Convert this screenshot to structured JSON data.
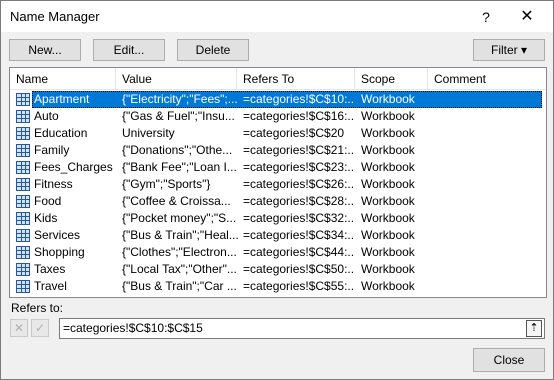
{
  "window": {
    "title": "Name Manager",
    "help_label": "?",
    "close_label": "✕"
  },
  "toolbar": {
    "new_label": "New...",
    "edit_label": "Edit...",
    "delete_label": "Delete",
    "filter_label": "Filter ▾"
  },
  "list": {
    "columns": [
      "Name",
      "Value",
      "Refers To",
      "Scope",
      "Comment"
    ],
    "rows": [
      {
        "name": "Apartment",
        "value": "{\"Electricity\";\"Fees\";...",
        "refers": "=categories!$C$10:...",
        "scope": "Workbook",
        "comment": "",
        "selected": true
      },
      {
        "name": "Auto",
        "value": "{\"Gas & Fuel\";\"Insu...",
        "refers": "=categories!$C$16:...",
        "scope": "Workbook",
        "comment": ""
      },
      {
        "name": "Education",
        "value": "University",
        "refers": "=categories!$C$20",
        "scope": "Workbook",
        "comment": ""
      },
      {
        "name": "Family",
        "value": "{\"Donations\";\"Othe...",
        "refers": "=categories!$C$21:...",
        "scope": "Workbook",
        "comment": ""
      },
      {
        "name": "Fees_Charges",
        "value": "{\"Bank Fee\";\"Loan I...",
        "refers": "=categories!$C$23:...",
        "scope": "Workbook",
        "comment": ""
      },
      {
        "name": "Fitness",
        "value": "{\"Gym\";\"Sports\"}",
        "refers": "=categories!$C$26:...",
        "scope": "Workbook",
        "comment": ""
      },
      {
        "name": "Food",
        "value": "{\"Coffee & Croissa...",
        "refers": "=categories!$C$28:...",
        "scope": "Workbook",
        "comment": ""
      },
      {
        "name": "Kids",
        "value": "{\"Pocket money\";\"S...",
        "refers": "=categories!$C$32:...",
        "scope": "Workbook",
        "comment": ""
      },
      {
        "name": "Services",
        "value": "{\"Bus & Train\";\"Heal...",
        "refers": "=categories!$C$34:...",
        "scope": "Workbook",
        "comment": ""
      },
      {
        "name": "Shopping",
        "value": "{\"Clothes\";\"Electron...",
        "refers": "=categories!$C$44:...",
        "scope": "Workbook",
        "comment": ""
      },
      {
        "name": "Taxes",
        "value": "{\"Local Tax\";\"Other\"...",
        "refers": "=categories!$C$50:...",
        "scope": "Workbook",
        "comment": ""
      },
      {
        "name": "Travel",
        "value": "{\"Bus & Train\";\"Car ...",
        "refers": "=categories!$C$55:...",
        "scope": "Workbook",
        "comment": ""
      }
    ]
  },
  "refers_to": {
    "label": "Refers to:",
    "value": "=categories!$C$10:$C$15",
    "cancel_icon": "✕",
    "confirm_icon": "✓",
    "collapse_icon": "⇡"
  },
  "footer": {
    "close_label": "Close"
  },
  "colors": {
    "selection": "#0078d7",
    "background": "#f0f0f0"
  }
}
